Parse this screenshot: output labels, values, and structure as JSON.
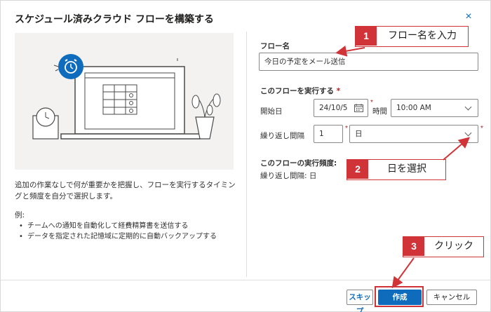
{
  "dialog": {
    "title": "スケジュール済みクラウド フローを構築する",
    "close": "×",
    "description": "追加の作業なしで何が重要かを把握し、フローを実行するタイミングと頻度を自分で選択します。",
    "example_title": "例:",
    "examples": [
      "チームへの通知を自動化して経費精算書を送信する",
      "データを指定された記憶域に定期的に自動バックアップする"
    ]
  },
  "form": {
    "flow_name_label": "フロー名",
    "flow_name_value": "今日の予定をメール送信",
    "run_label": "このフローを実行する",
    "required_mark": "*",
    "start_label": "開始日",
    "start_date": "24/10/5",
    "time_label": "時間",
    "time_value": "10:00 AM",
    "repeat_label": "繰り返し間隔",
    "repeat_count": "1",
    "repeat_unit": "日",
    "frequency_title": "このフローの実行頻度:",
    "frequency_value": "繰り返し間隔: 日"
  },
  "footer": {
    "skip_label": "スキップ",
    "create_label": "作成",
    "cancel_label": "キャンセル"
  },
  "callouts": [
    {
      "num": "1",
      "text": "フロー名を入力"
    },
    {
      "num": "2",
      "text": "日を選択"
    },
    {
      "num": "3",
      "text": "クリック"
    }
  ],
  "icons": {
    "close": "close-icon",
    "calendar": "calendar-icon",
    "chevron": "chevron-down-icon",
    "alarm": "alarm-clock-icon"
  },
  "colors": {
    "accent": "#0f6cbd",
    "annotation": "#d13438"
  }
}
